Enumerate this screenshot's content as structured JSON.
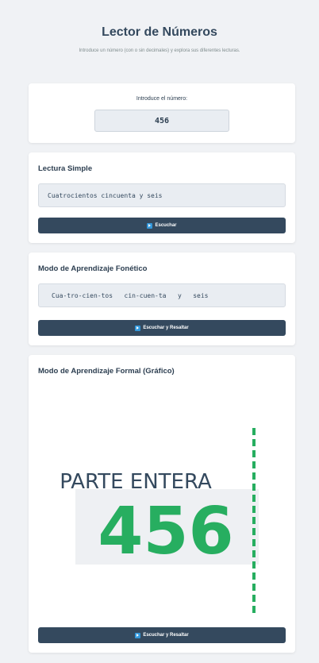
{
  "header": {
    "title": "Lector de Números",
    "subtitle": "Introduce un número (con o sin decimales) y explora sus diferentes lecturas."
  },
  "input_section": {
    "label": "Introduce el número:",
    "value": "456"
  },
  "simple_reading": {
    "title": "Lectura Simple",
    "text": "Cuatrocientos cincuenta y seis",
    "button_label": "Escuchar"
  },
  "phonetic_mode": {
    "title": "Modo de Aprendizaje Fonético",
    "text": "Cua-tro-cien-tos   cin-cuen-ta   y   seis",
    "button_label": "Escuchar y Resaltar"
  },
  "formal_mode": {
    "title": "Modo de Aprendizaje Formal (Gráfico)",
    "graphic_label": "PARTE ENTERA",
    "graphic_number": "456",
    "button_label": "Escuchar y Resaltar"
  },
  "colors": {
    "background": "#f0f2f5",
    "dark_button": "#34495e",
    "number_green": "#27ae60",
    "play_icon": "#3498db"
  },
  "icons": [
    "play-icon"
  ]
}
